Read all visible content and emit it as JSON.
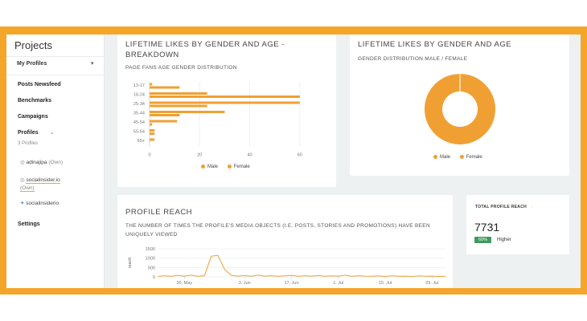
{
  "sidebar": {
    "title": "Projects",
    "my_profiles": "My Profiles",
    "nav": [
      {
        "label": "Posts Newsfeed"
      },
      {
        "label": "Benchmarks"
      },
      {
        "label": "Campaigns"
      },
      {
        "label": "Profiles"
      }
    ],
    "profiles_count": "3 Profiles",
    "profiles": [
      {
        "icon": "instagram-icon",
        "name": "adinajipa",
        "own": "(Own)"
      },
      {
        "icon": "instagram-icon",
        "name": "socialinsider.io",
        "own": "(Own)"
      },
      {
        "icon": "twitter-icon",
        "name": "socialinsiderio",
        "own": ""
      }
    ],
    "settings": "Settings"
  },
  "colors": {
    "accent": "#f4a62a",
    "series": "#f0a033",
    "badge": "#3f9b5e"
  },
  "breakdown_card": {
    "title": "LIFETIME LIKES BY GENDER AND AGE - BREAKDOWN",
    "subtitle": "PAGE FANS AGE GENDER DISTRIBUTION"
  },
  "gender_card": {
    "title": "LIFETIME LIKES BY GENDER AND AGE",
    "subtitle": "GENDER DISTRIBUTION MALE / FEMALE"
  },
  "reach_card": {
    "title": "PROFILE REACH",
    "subtitle": "THE NUMBER OF TIMES THE PROFILE'S MEDIA OBJECTS (I.E. POSTS, STORIES AND PROMOTIONS) HAVE BEEN UNIQUELY VIEWED"
  },
  "total_reach": {
    "label": "TOTAL PROFILE REACH",
    "value": "7731",
    "badge": "60%",
    "badge_text": "Higher"
  },
  "chart_data": [
    {
      "type": "bar",
      "orientation": "horizontal",
      "categories": [
        "13-17",
        "18-24",
        "25-34",
        "35-44",
        "45-54",
        "55-64",
        "65+"
      ],
      "series": [
        {
          "name": "Male",
          "values": [
            1,
            23,
            60,
            30,
            11,
            2,
            2
          ]
        },
        {
          "name": "Female",
          "values": [
            12,
            60,
            23,
            12,
            1,
            2,
            0
          ]
        }
      ],
      "xticks": [
        "0",
        "20",
        "40",
        "60"
      ],
      "xlim": [
        0,
        70
      ],
      "legend": "bottom",
      "grid": true
    },
    {
      "type": "pie",
      "donut": true,
      "series": [
        {
          "name": "Male",
          "values": [
            0.5
          ]
        },
        {
          "name": "Female",
          "values": [
            99.5
          ]
        }
      ],
      "legend": "bottom"
    },
    {
      "type": "line",
      "ylabel": "reach",
      "yticks": [
        "0",
        "500",
        "1000",
        "1500"
      ],
      "ylim": [
        0,
        1500
      ],
      "xticks": [
        "20. May",
        "3. Jun",
        "17. Jun",
        "1. Jul",
        "15. Jul",
        "29. Jul"
      ],
      "series": [
        {
          "name": "reach",
          "x": [
            "12. May",
            "14. May",
            "16. May",
            "18. May",
            "20. May",
            "22. May",
            "24. May",
            "26. May",
            "27. May",
            "28. May",
            "29. May",
            "30. May",
            "1. Jun",
            "3. Jun",
            "5. Jun",
            "7. Jun",
            "9. Jun",
            "11. Jun",
            "13. Jun",
            "15. Jun",
            "17. Jun",
            "19. Jun",
            "21. Jun",
            "23. Jun",
            "25. Jun",
            "27. Jun",
            "29. Jun",
            "1. Jul",
            "3. Jul",
            "5. Jul",
            "7. Jul",
            "9. Jul",
            "11. Jul",
            "13. Jul",
            "15. Jul",
            "17. Jul",
            "19. Jul",
            "21. Jul",
            "23. Jul",
            "25. Jul",
            "27. Jul",
            "29. Jul",
            "31. Jul",
            "2. Aug"
          ],
          "values": [
            20,
            60,
            30,
            80,
            40,
            90,
            30,
            60,
            1100,
            1150,
            400,
            80,
            40,
            70,
            30,
            90,
            40,
            60,
            30,
            50,
            80,
            30,
            60,
            40,
            70,
            30,
            50,
            40,
            90,
            30,
            60,
            40,
            30,
            50,
            20,
            60,
            30,
            40,
            20,
            50,
            30,
            40,
            20,
            30
          ]
        }
      ]
    }
  ]
}
